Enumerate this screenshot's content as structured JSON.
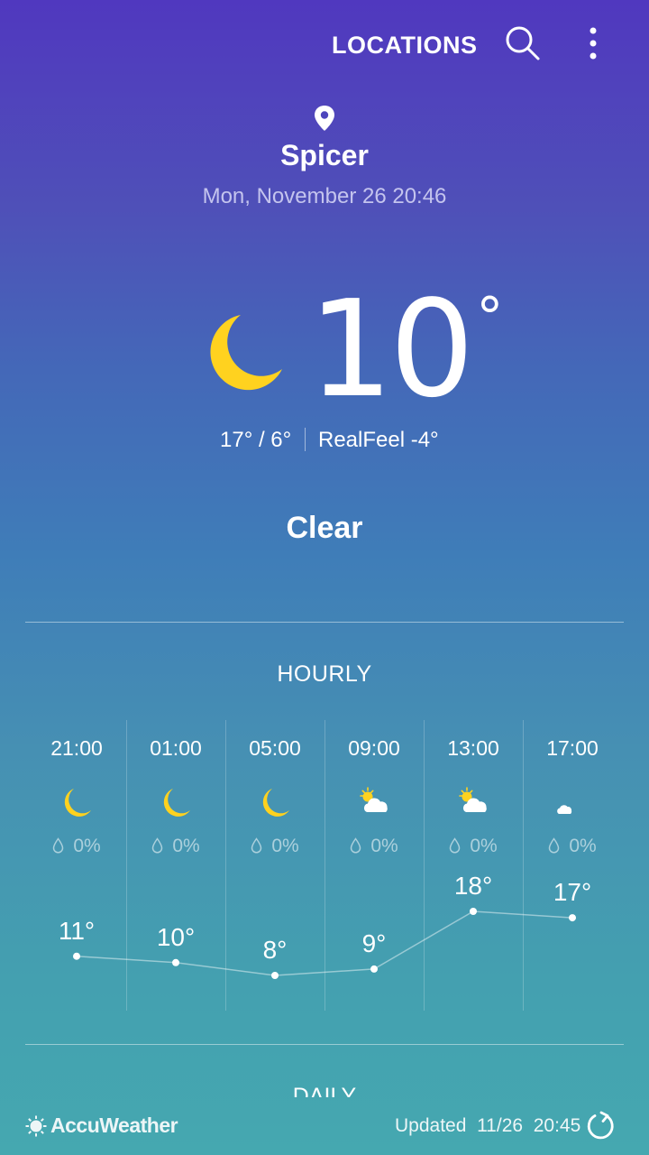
{
  "header": {
    "locations_label": "LOCATIONS",
    "icons": [
      "search-icon",
      "more-vert-icon"
    ]
  },
  "location": {
    "city": "Spicer",
    "datetime": "Mon, November 26 20:46",
    "icon": "location-pin-icon"
  },
  "current": {
    "temp": "10",
    "degree": "°",
    "hilo": "17° / 6°",
    "realfeel": "RealFeel -4°",
    "condition": "Clear",
    "icon": "moon-icon"
  },
  "colors": {
    "moon": "#ffd21f",
    "bg_top": "#5038bf",
    "bg_bottom": "#45a8b0"
  },
  "hourly": {
    "title": "HOURLY",
    "items": [
      {
        "time": "21:00",
        "icon": "moon-icon",
        "precip": "0%",
        "temp": "11°",
        "value": 11
      },
      {
        "time": "01:00",
        "icon": "moon-icon",
        "precip": "0%",
        "temp": "10°",
        "value": 10
      },
      {
        "time": "05:00",
        "icon": "moon-icon",
        "precip": "0%",
        "temp": "8°",
        "value": 8
      },
      {
        "time": "09:00",
        "icon": "sun-cloud-icon",
        "precip": "0%",
        "temp": "9°",
        "value": 9
      },
      {
        "time": "13:00",
        "icon": "sun-cloud-icon",
        "precip": "0%",
        "temp": "18°",
        "value": 18
      },
      {
        "time": "17:00",
        "icon": "moon-cloud-icon",
        "precip": "0%",
        "temp": "17°",
        "value": 17
      }
    ]
  },
  "daily": {
    "title": "DAILY"
  },
  "footer": {
    "brand": "AccuWeather",
    "updated": "Updated  11/26  20:45",
    "icon": "refresh-icon"
  }
}
